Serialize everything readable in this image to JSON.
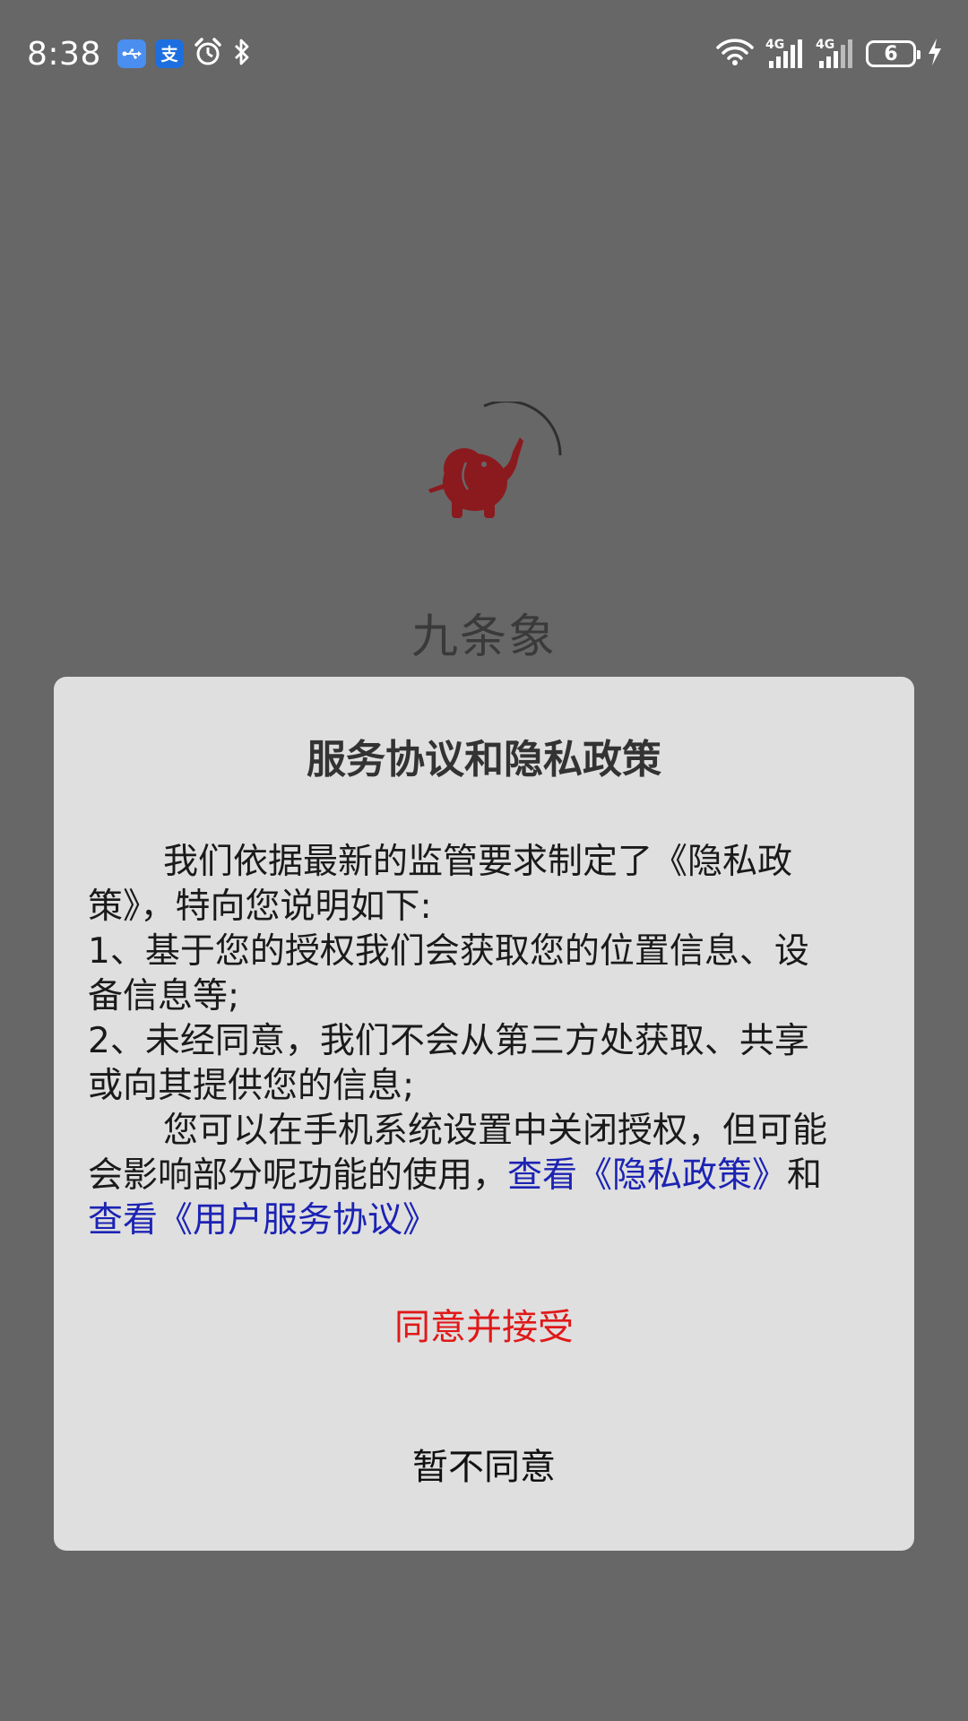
{
  "status_bar": {
    "time": "8:38",
    "app_icons": [
      "usb-debug-icon",
      "alipay-icon",
      "alarm-icon",
      "bluetooth-icon"
    ],
    "network_labels": [
      "4G",
      "4G"
    ],
    "battery_level": "6"
  },
  "splash": {
    "app_name": "九条象",
    "logo_color": "#8b1a1f"
  },
  "dialog": {
    "title": "服务协议和隐私政策",
    "lines": {
      "l1": "我们依据最新的监管要求制定了《隐私政",
      "l2": "策》，特向您说明如下:",
      "l3": "1、基于您的授权我们会获取您的位置信息、设",
      "l4": "备信息等;",
      "l5": "2、未经同意，我们不会从第三方处获取、共享",
      "l6": "或向其提供您的信息;",
      "l7": "您可以在手机系统设置中关闭授权，但可能",
      "l8_prefix": "会影响部分呢功能的使用，",
      "l8_suffix": "和"
    },
    "privacy_link": "查看《隐私政策》",
    "service_link": "查看《用户服务协议》",
    "agree_label": "同意并接受",
    "disagree_label": "暂不同意"
  },
  "colors": {
    "backdrop": "#676767",
    "dialog_bg": "#dfdfdf",
    "link": "#1c23b3",
    "agree": "#e01919"
  }
}
